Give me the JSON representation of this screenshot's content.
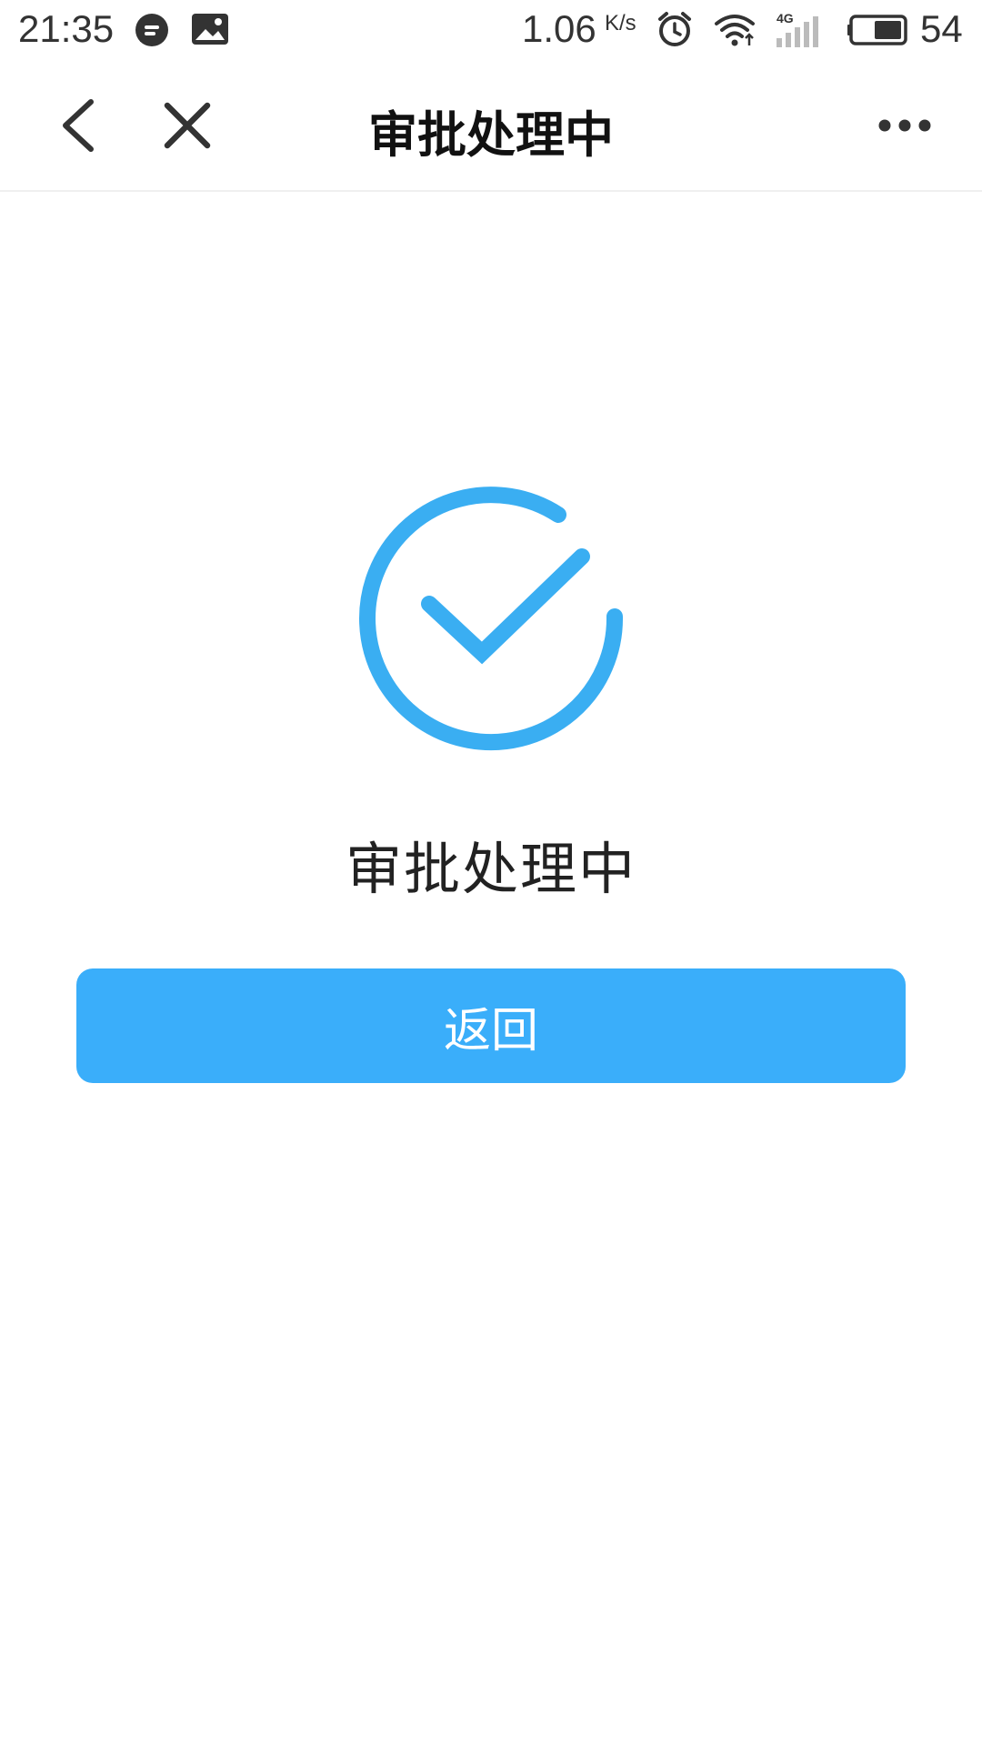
{
  "status_bar": {
    "time": "21:35",
    "speed_value": "1.06",
    "speed_unit": "K/s",
    "network": "4G",
    "battery": "54",
    "icons": [
      "chat-icon",
      "image-icon",
      "alarm-icon",
      "wifi-icon",
      "signal-icon",
      "battery-icon"
    ]
  },
  "nav": {
    "title": "审批处理中",
    "back_icon": "chevron-left-icon",
    "close_icon": "close-icon",
    "more_icon": "more-icon"
  },
  "main": {
    "status_text": "审批处理中",
    "icon": "check-circle-icon",
    "button_label": "返回"
  },
  "colors": {
    "accent": "#3aaefa",
    "icon_blue": "#3aaef2",
    "text": "#222222"
  }
}
